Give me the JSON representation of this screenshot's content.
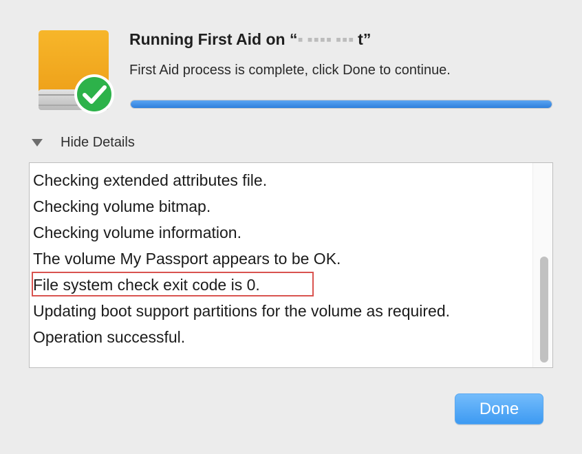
{
  "dialog": {
    "title_prefix": "Running First Aid on “",
    "title_volume": "▪ ▪▪▪▪ ▪▪▪ ",
    "title_suffix": "t”",
    "subtitle": "First Aid process is complete, click Done to continue.",
    "progress_percent": 100,
    "accent_color": "#3d9af2",
    "icons": {
      "drive": "external-drive-icon",
      "badge": "checkmark-badge-icon",
      "disclosure": "disclosure-triangle-icon"
    }
  },
  "details": {
    "toggle_label": "Hide Details",
    "log_lines": [
      "Checking extended attributes file.",
      "Checking volume bitmap.",
      "Checking volume information.",
      "The volume My Passport appears to be OK.",
      "File system check exit code is 0.",
      "Updating boot support partitions for the volume as required.",
      "Operation successful."
    ],
    "highlight_color": "#d9534f"
  },
  "buttons": {
    "done_label": "Done"
  }
}
